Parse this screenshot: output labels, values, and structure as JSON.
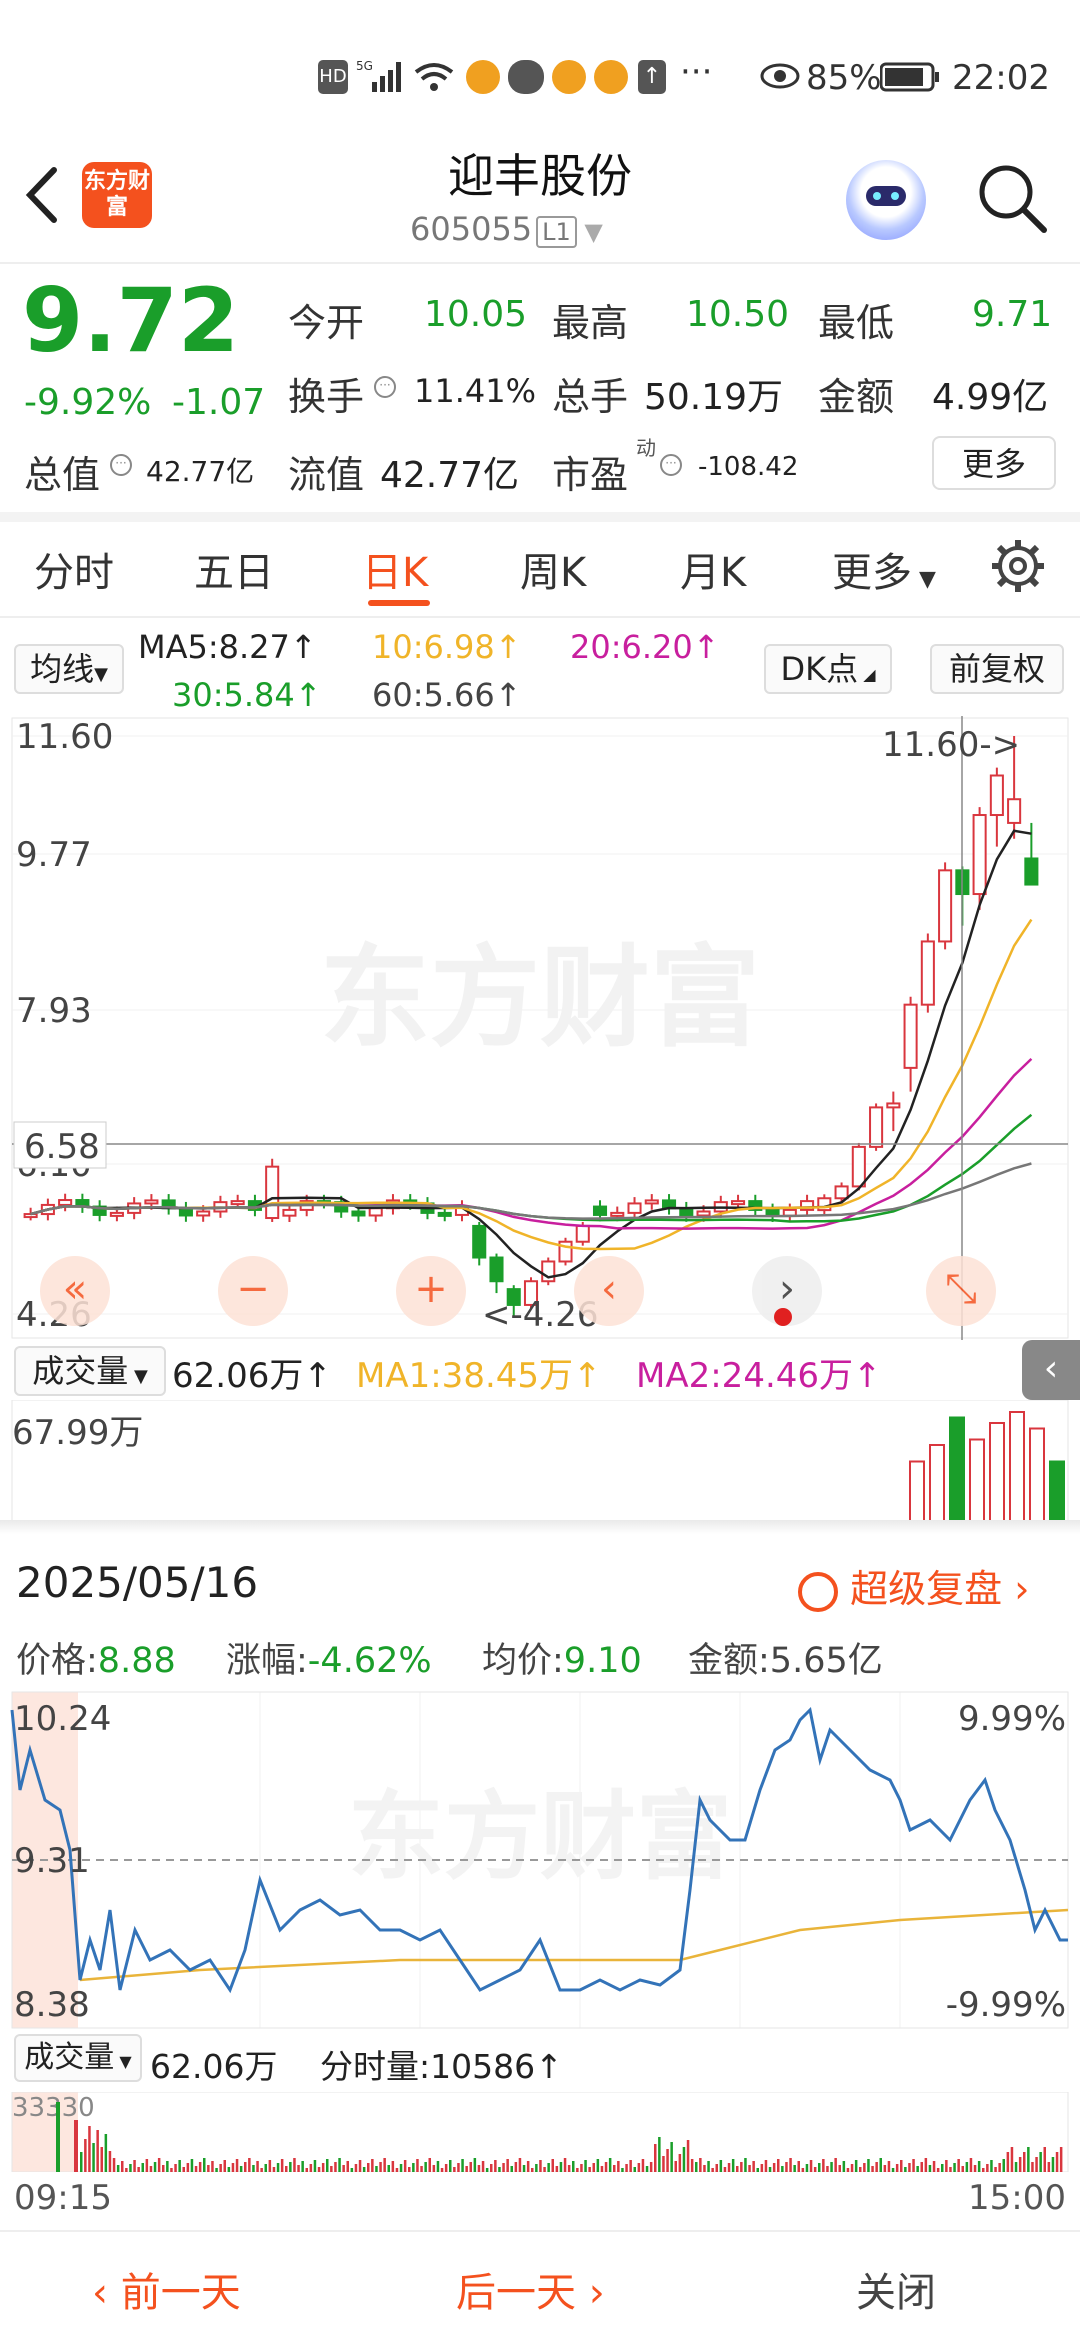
{
  "status_bar": {
    "icons": [
      "hd-icon",
      "signal-5g-icon",
      "wifi-icon",
      "weibo-icon",
      "wechat-icon",
      "weibo-icon",
      "weibo-icon",
      "upload-icon",
      "more-dots-icon",
      "eye-icon",
      "battery-icon"
    ],
    "battery": "85%",
    "time": "22:02"
  },
  "header": {
    "logo_text": "东方财富",
    "stock_name": "迎丰股份",
    "stock_code": "605055",
    "level": "L1"
  },
  "quote": {
    "last_price": "9.72",
    "change_pct": "-9.92%",
    "change_amt": "-1.07",
    "open_label": "今开",
    "open_val": "10.05",
    "high_label": "最高",
    "high_val": "10.50",
    "low_label": "最低",
    "low_val": "9.71",
    "turnover_label": "换手",
    "turnover_val": "11.41%",
    "volume_label": "总手",
    "volume_val": "50.19万",
    "amount_label": "金额",
    "amount_val": "4.99亿",
    "mcap_label": "总值",
    "mcap_val": "42.77亿",
    "float_label": "流值",
    "float_val": "42.77亿",
    "pe_label": "市盈",
    "pe_sup": "动",
    "pe_val": "-108.42",
    "more_label": "更多"
  },
  "tabs": [
    "分时",
    "五日",
    "日K",
    "周K",
    "月K",
    "更多"
  ],
  "active_tab": "日K",
  "ma_row": {
    "selector": "均线",
    "ma5": "MA5:8.27↑",
    "ma10": "10:6.98↑",
    "ma20": "20:6.20↑",
    "ma30": "30:5.84↑",
    "ma60": "60:5.66↑",
    "dk_label": "DK点",
    "adjust_label": "前复权"
  },
  "kline": {
    "y_labels": [
      "11.60",
      "9.77",
      "7.93",
      "6.10",
      "4.26"
    ],
    "crosshair_price": "6.58",
    "max_marker": "11.60->",
    "min_marker": "<-4.26",
    "watermark": "东方财富",
    "colors": {
      "up": "#d9363e",
      "down": "#1a9e2a",
      "ma5": "#222222",
      "ma10": "#f0b429",
      "ma20": "#c81f9e",
      "ma30": "#1a9e2a",
      "ma60": "#777777"
    }
  },
  "vol_row": {
    "selector": "成交量",
    "vol": "62.06万↑",
    "ma1": "MA1:38.45万↑",
    "ma2": "MA2:24.46万↑",
    "max_label": "67.99万"
  },
  "popup": {
    "date": "2025/05/16",
    "replay_label": "超级复盘",
    "price_label": "价格:",
    "price_val": "8.88",
    "pct_label": "涨幅:",
    "pct_val": "-4.62%",
    "avg_label": "均价:",
    "avg_val": "9.10",
    "amt_label": "金额:",
    "amt_val": "5.65亿",
    "y_high": "10.24",
    "y_mid": "9.31",
    "y_low": "8.38",
    "pct_high": "9.99%",
    "pct_low": "-9.99%",
    "vol_selector": "成交量",
    "vol_val": "62.06万",
    "minute_vol": "分时量:10586↑",
    "vol_max": "33330",
    "time_start": "09:15",
    "time_end": "15:00",
    "prev_day": "前一天",
    "next_day": "后一天",
    "close": "关闭"
  }
}
